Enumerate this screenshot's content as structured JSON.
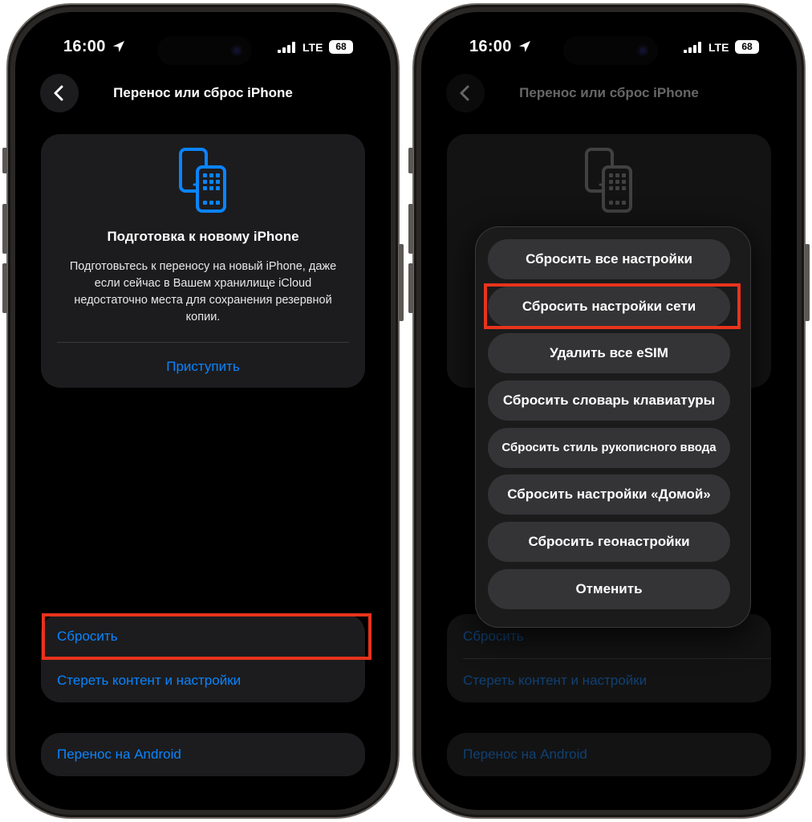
{
  "status_bar": {
    "time": "16:00",
    "network": "LTE",
    "battery": "68"
  },
  "left": {
    "nav_title": "Перенос или сброс iPhone",
    "card": {
      "title": "Подготовка к новому iPhone",
      "text": "Подготовьтесь к переносу на новый iPhone, даже если сейчас в Вашем хранилище iCloud недостаточно места для сохранения резервной копии.",
      "link": "Приступить"
    },
    "group": [
      "Сбросить",
      "Стереть контент и настройки"
    ],
    "android": "Перенос на Android"
  },
  "right": {
    "nav_title": "Перенос или сброс iPhone",
    "group": [
      "Сбросить",
      "Стереть контент и настройки"
    ],
    "android": "Перенос на Android",
    "menu": [
      "Сбросить все настройки",
      "Сбросить настройки сети",
      "Удалить все eSIM",
      "Сбросить словарь клавиатуры",
      "Сбросить стиль рукописного ввода",
      "Сбросить настройки «Домой»",
      "Сбросить геонастройки",
      "Отменить"
    ]
  },
  "colors": {
    "accent": "#0a84ff",
    "highlight": "#e8331c",
    "card": "#1c1c1e",
    "menu_item": "#343436"
  },
  "icons": [
    "location-arrow-icon",
    "cellular-signal-icon",
    "battery-icon",
    "chevron-left-icon",
    "transfer-phones-icon"
  ]
}
